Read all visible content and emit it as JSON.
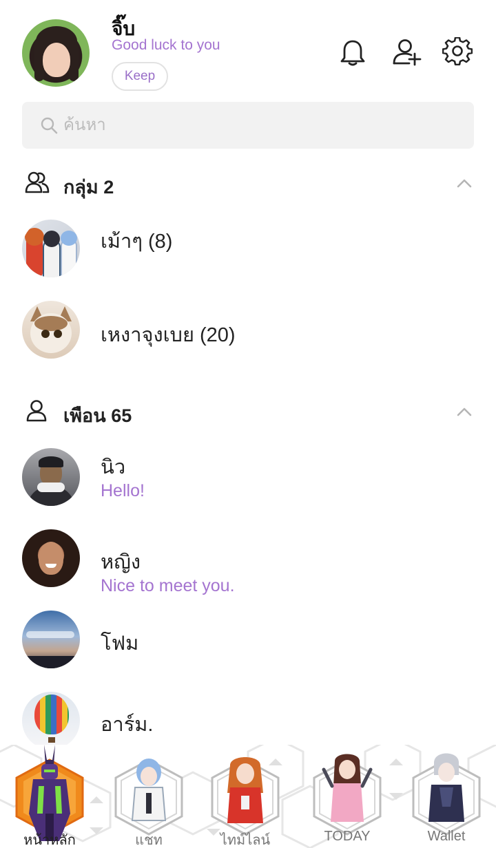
{
  "profile": {
    "name": "จิ๊บ",
    "status": "Good luck to you",
    "keep_label": "Keep"
  },
  "header_icons": [
    "bell-icon",
    "add-friend-icon",
    "settings-gear-icon"
  ],
  "search": {
    "placeholder": "ค้นหา",
    "value": ""
  },
  "groups": {
    "title": "กลุ่ม 2",
    "icon": "group-icon",
    "items": [
      {
        "name": "เม้าๆ (8)"
      },
      {
        "name": "เหงาจุงเบย (20)"
      }
    ]
  },
  "friends": {
    "title": "เพือน 65",
    "icon": "person-icon",
    "items": [
      {
        "name": "นิว",
        "message": "Hello!"
      },
      {
        "name": "หญิง",
        "message": "Nice to meet you."
      },
      {
        "name": "โฟม",
        "message": ""
      },
      {
        "name": "อาร์ม.",
        "message": ""
      }
    ]
  },
  "tabs": [
    {
      "label": "หน้าหลัก",
      "active": true
    },
    {
      "label": "แชท",
      "active": false
    },
    {
      "label": "ไทม์ไลน์",
      "active": false
    },
    {
      "label": "TODAY",
      "active": false
    },
    {
      "label": "Wallet",
      "active": false
    }
  ],
  "colors": {
    "accent_purple": "#a474d0",
    "active_tab_hex": "#f08a1c",
    "search_bg": "#f2f2f2"
  }
}
